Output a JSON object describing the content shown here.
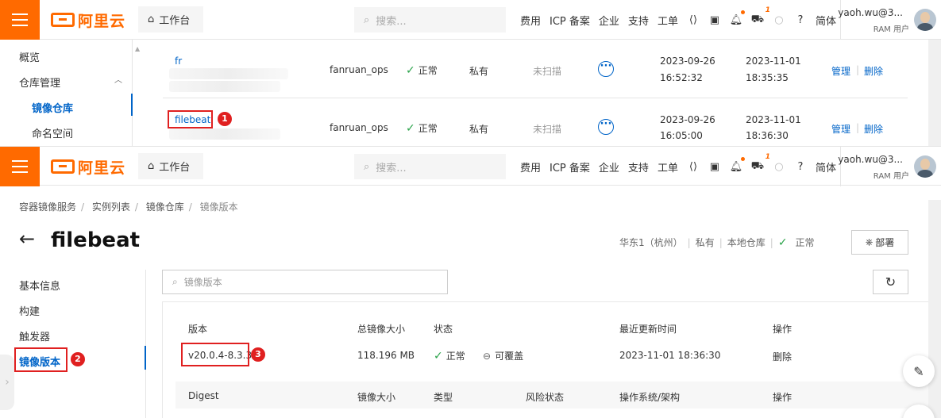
{
  "header": {
    "logo_text": "阿里云",
    "workbench": "工作台",
    "search_placeholder": "搜索...",
    "nav": [
      "费用",
      "ICP 备案",
      "企业",
      "支持",
      "工单"
    ],
    "cart_count": "1",
    "language": "简体",
    "user_name": "yaoh.wu@3...",
    "user_role": "RAM 用户"
  },
  "top_panel": {
    "sidebar": {
      "overview": "概览",
      "repo_management": "仓库管理",
      "image_repo": "镜像仓库",
      "namespace": "命名空间"
    },
    "rows": [
      {
        "name": "fr",
        "namespace": "fanruan_ops",
        "status": "正常",
        "type": "私有",
        "scan": "未扫描",
        "created_date": "2023-09-26",
        "created_time": "16:52:32",
        "updated_date": "2023-11-01",
        "updated_time": "18:35:35",
        "manage": "管理",
        "delete": "删除"
      },
      {
        "name": "filebeat",
        "namespace": "fanruan_ops",
        "status": "正常",
        "type": "私有",
        "scan": "未扫描",
        "created_date": "2023-09-26",
        "created_time": "16:05:00",
        "updated_date": "2023-11-01",
        "updated_time": "18:36:30",
        "manage": "管理",
        "delete": "删除"
      }
    ],
    "step1": "1"
  },
  "bottom_panel": {
    "breadcrumb": [
      "容器镜像服务",
      "实例列表",
      "镜像仓库",
      "镜像版本"
    ],
    "title": "filebeat",
    "meta": {
      "region": "华东1（杭州）",
      "type": "私有",
      "source": "本地仓库",
      "status": "正常"
    },
    "deploy_button": "部署",
    "sidebar": [
      "基本信息",
      "构建",
      "触发器",
      "镜像版本"
    ],
    "step2": "2",
    "search_placeholder": "镜像版本",
    "table": {
      "headers": [
        "版本",
        "总镜像大小",
        "状态",
        "最近更新时间",
        "操作"
      ],
      "row": {
        "version": "v20.0.4-8.3.3",
        "size": "118.196 MB",
        "status": "正常",
        "overwrite": "可覆盖",
        "updated": "2023-11-01 18:36:30",
        "action": "删除"
      },
      "subheaders": [
        "Digest",
        "镜像大小",
        "类型",
        "风险状态",
        "操作系统/架构",
        "操作"
      ]
    },
    "step3": "3"
  }
}
